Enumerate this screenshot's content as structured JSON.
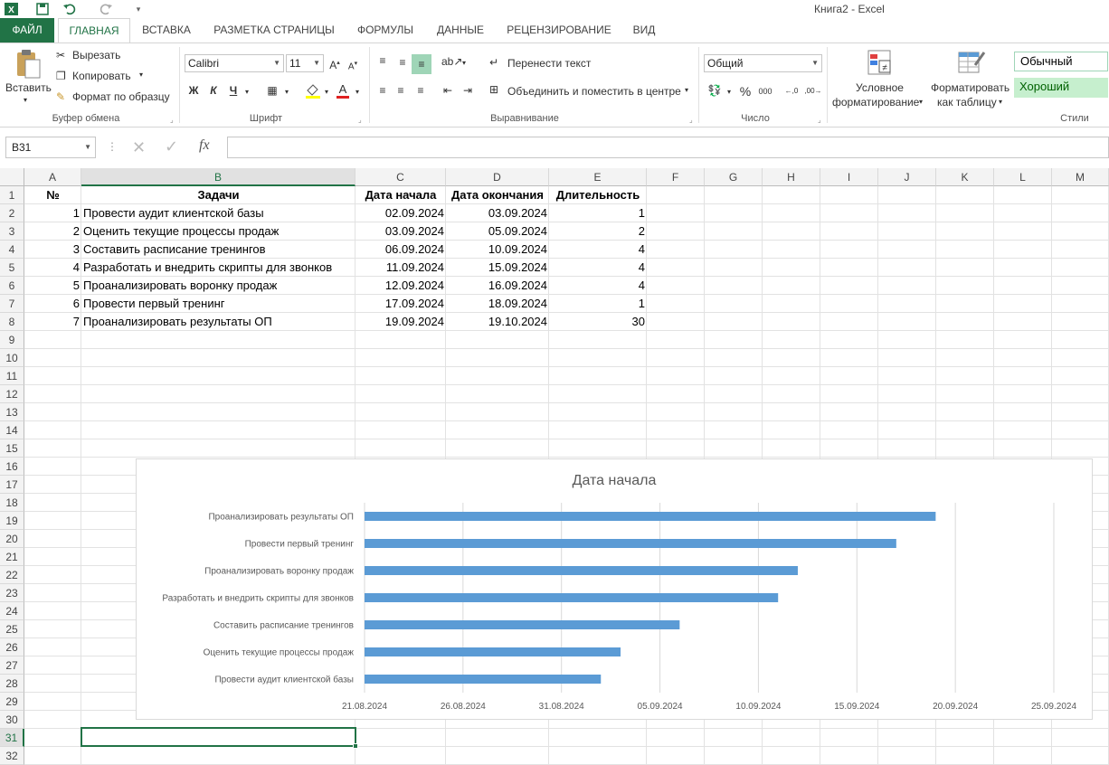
{
  "window": {
    "title": "Книга2 - Excel"
  },
  "tabs": [
    "ФАЙЛ",
    "ГЛАВНАЯ",
    "ВСТАВКА",
    "РАЗМЕТКА СТРАНИЦЫ",
    "ФОРМУЛЫ",
    "ДАННЫЕ",
    "РЕЦЕНЗИРОВАНИЕ",
    "ВИД"
  ],
  "ribbon": {
    "clipboard": {
      "paste": "Вставить",
      "cut": "Вырезать",
      "copy": "Копировать",
      "format_painter": "Формат по образцу",
      "label": "Буфер обмена"
    },
    "font": {
      "name": "Calibri",
      "size": "11",
      "bold": "Ж",
      "italic": "К",
      "underline": "Ч",
      "label": "Шрифт"
    },
    "alignment": {
      "wrap": "Перенести текст",
      "merge": "Объединить и поместить в центре",
      "label": "Выравнивание"
    },
    "number": {
      "format": "Общий",
      "label": "Число"
    },
    "styles": {
      "cond_format_1": "Условное",
      "cond_format_2": "форматирование",
      "table_format_1": "Форматировать",
      "table_format_2": "как таблицу",
      "normal": "Обычный",
      "good": "Хороший",
      "label": "Стили"
    }
  },
  "formula_bar": {
    "name_box": "B31",
    "fx": "fx",
    "value": ""
  },
  "columns": [
    "A",
    "B",
    "C",
    "D",
    "E",
    "F",
    "G",
    "H",
    "I",
    "J",
    "K",
    "L",
    "M"
  ],
  "rows": [
    "1",
    "2",
    "3",
    "4",
    "5",
    "6",
    "7",
    "8",
    "9",
    "10",
    "11",
    "12",
    "13",
    "14",
    "15",
    "16",
    "17",
    "18",
    "19",
    "20",
    "21",
    "22",
    "23",
    "24",
    "25",
    "26",
    "27",
    "28",
    "29",
    "30",
    "31",
    "32"
  ],
  "table": {
    "headers": [
      "№",
      "Задачи",
      "Дата начала",
      "Дата окончания",
      "Длительность"
    ],
    "rows": [
      [
        "1",
        "Провести аудит клиентской базы",
        "02.09.2024",
        "03.09.2024",
        "1"
      ],
      [
        "2",
        "Оценить текущие процессы продаж",
        "03.09.2024",
        "05.09.2024",
        "2"
      ],
      [
        "3",
        "Составить расписание тренингов",
        "06.09.2024",
        "10.09.2024",
        "4"
      ],
      [
        "4",
        "Разработать и внедрить скрипты для звонков",
        "11.09.2024",
        "15.09.2024",
        "4"
      ],
      [
        "5",
        "Проанализировать воронку продаж",
        "12.09.2024",
        "16.09.2024",
        "4"
      ],
      [
        "6",
        "Провести первый тренинг",
        "17.09.2024",
        "18.09.2024",
        "1"
      ],
      [
        "7",
        "Проанализировать результаты ОП",
        "19.09.2024",
        "19.10.2024",
        "30"
      ]
    ]
  },
  "chart_data": {
    "type": "bar",
    "orientation": "horizontal",
    "title": "Дата начала",
    "categories": [
      "Провести аудит клиентской базы",
      "Оценить текущие процессы продаж",
      "Составить расписание тренингов",
      "Разработать и внедрить скрипты для звонков",
      "Проанализировать воронку продаж",
      "Провести первый тренинг",
      "Проанализировать результаты ОП"
    ],
    "values": [
      "2024-09-02",
      "2024-09-03",
      "2024-09-06",
      "2024-09-11",
      "2024-09-12",
      "2024-09-17",
      "2024-09-19"
    ],
    "xlim": [
      "2024-08-21",
      "2024-09-25"
    ],
    "x_ticks": [
      "21.08.2024",
      "26.08.2024",
      "31.08.2024",
      "05.09.2024",
      "10.09.2024",
      "15.09.2024",
      "20.09.2024",
      "25.09.2024"
    ],
    "grid": true,
    "bar_color": "#5b9bd5"
  },
  "colors": {
    "accent": "#217346",
    "good_fill": "#c6efce",
    "good_text": "#006100"
  }
}
